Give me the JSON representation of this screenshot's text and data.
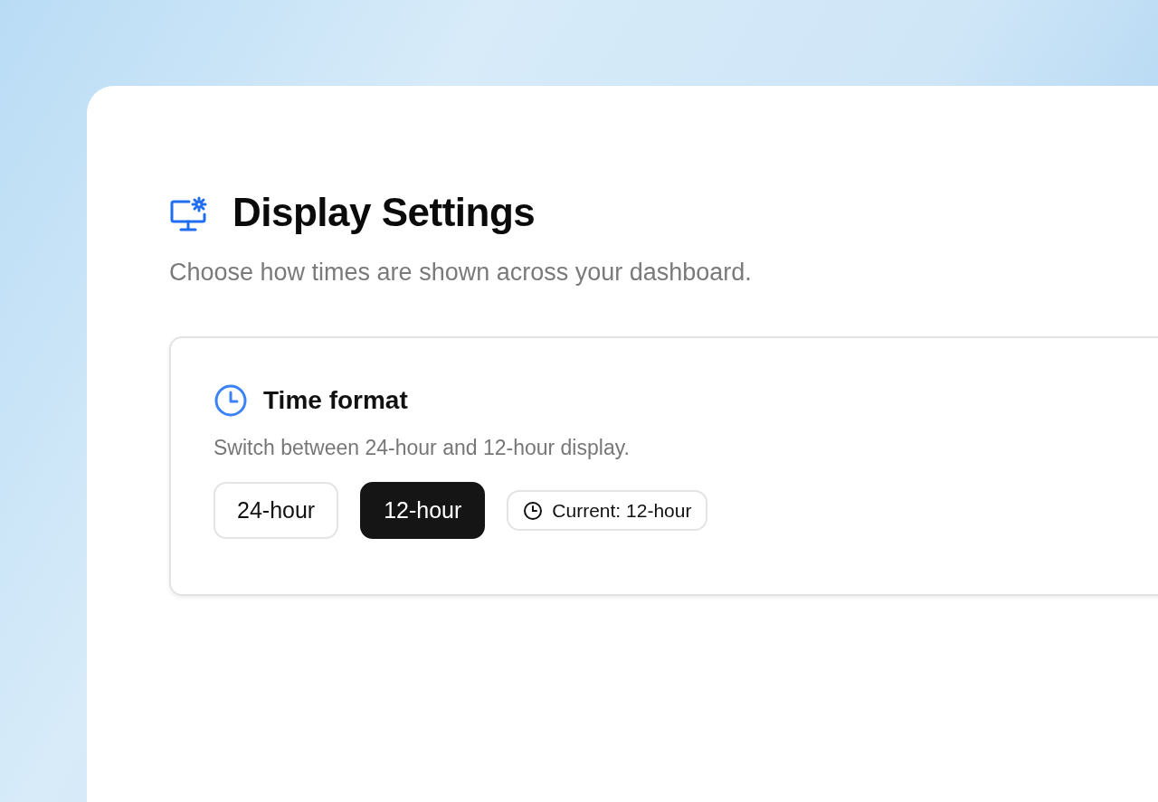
{
  "page": {
    "title": "Display Settings",
    "subtitle": "Choose how times are shown across your dashboard."
  },
  "card": {
    "title": "Time format",
    "description": "Switch between 24-hour and 12-hour display.",
    "options": [
      {
        "label": "24-hour",
        "selected": false
      },
      {
        "label": "12-hour",
        "selected": true
      }
    ],
    "current": "Current: 12-hour"
  }
}
